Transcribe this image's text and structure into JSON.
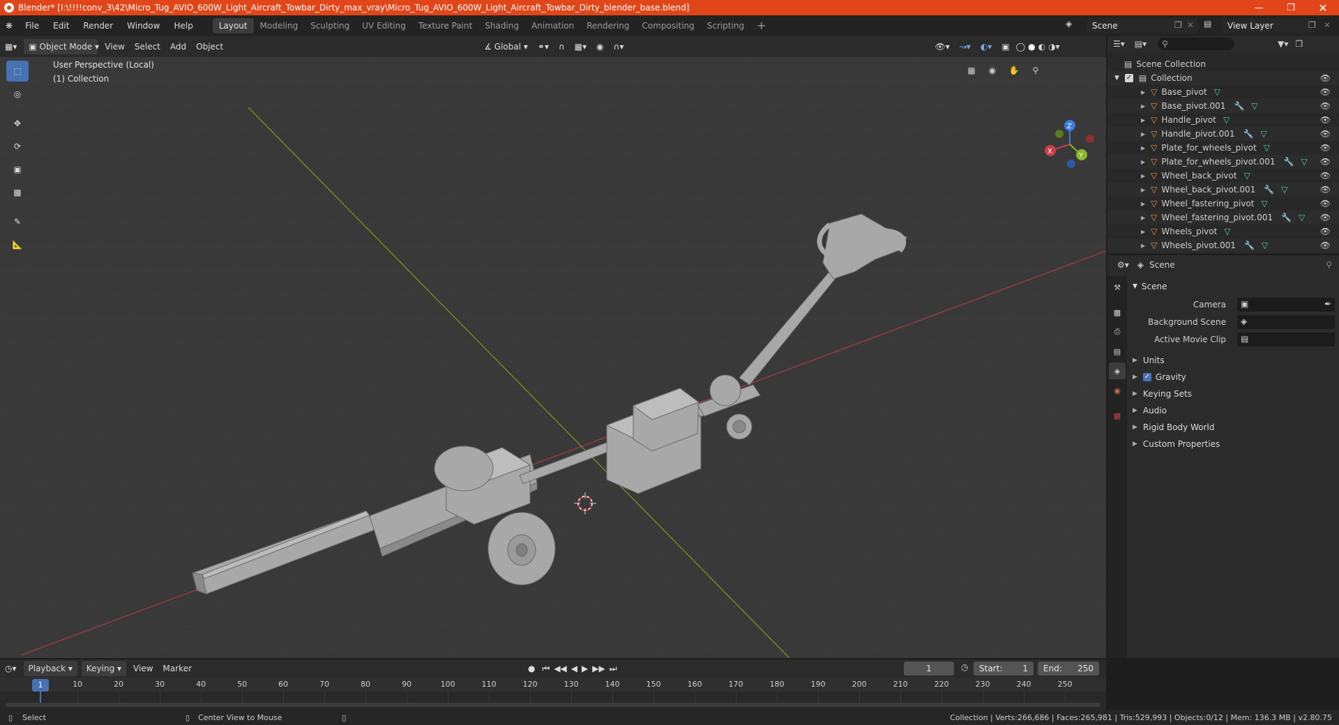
{
  "titlebar": {
    "title": "Blender* [I:\\!!!!conv_3\\42\\Micro_Tug_AVIO_600W_Light_Aircraft_Towbar_Dirty_max_vray\\Micro_Tug_AVIO_600W_Light_Aircraft_Towbar_Dirty_blender_base.blend]"
  },
  "menu": {
    "file": "File",
    "edit": "Edit",
    "render": "Render",
    "window": "Window",
    "help": "Help"
  },
  "workspaces": [
    "Layout",
    "Modeling",
    "Sculpting",
    "UV Editing",
    "Texture Paint",
    "Shading",
    "Animation",
    "Rendering",
    "Compositing",
    "Scripting"
  ],
  "scene": {
    "name": "Scene",
    "view_layer": "View Layer"
  },
  "viewport_header": {
    "mode": "Object Mode",
    "view": "View",
    "select": "Select",
    "add": "Add",
    "object": "Object",
    "orientation": "Global"
  },
  "viewport": {
    "perspective": "User Perspective (Local)",
    "collection": "(1) Collection"
  },
  "gizmo": {
    "x": "X",
    "y": "Y",
    "z": "Z"
  },
  "outliner": {
    "root": "Scene Collection",
    "collection": "Collection",
    "items": [
      {
        "name": "Base_pivot",
        "mod": false
      },
      {
        "name": "Base_pivot.001",
        "mod": true
      },
      {
        "name": "Handle_pivot",
        "mod": false
      },
      {
        "name": "Handle_pivot.001",
        "mod": true
      },
      {
        "name": "Plate_for_wheels_pivot",
        "mod": false
      },
      {
        "name": "Plate_for_wheels_pivot.001",
        "mod": true
      },
      {
        "name": "Wheel_back_pivot",
        "mod": false
      },
      {
        "name": "Wheel_back_pivot.001",
        "mod": true
      },
      {
        "name": "Wheel_fastering_pivot",
        "mod": false
      },
      {
        "name": "Wheel_fastering_pivot.001",
        "mod": true
      },
      {
        "name": "Wheels_pivot",
        "mod": false
      },
      {
        "name": "Wheels_pivot.001",
        "mod": true
      }
    ]
  },
  "properties": {
    "context": "Scene",
    "section": "Scene",
    "camera_label": "Camera",
    "background_label": "Background Scene",
    "movieclip_label": "Active Movie Clip",
    "panels": [
      "Units",
      "Gravity",
      "Keying Sets",
      "Audio",
      "Rigid Body World",
      "Custom Properties"
    ],
    "gravity_checked": true
  },
  "timeline": {
    "playback": "Playback",
    "keying": "Keying",
    "view": "View",
    "marker": "Marker",
    "current_frame": "1",
    "start_label": "Start:",
    "start": "1",
    "end_label": "End:",
    "end": "250",
    "ticks": [
      "10",
      "20",
      "30",
      "40",
      "50",
      "60",
      "70",
      "80",
      "90",
      "100",
      "110",
      "120",
      "130",
      "140",
      "150",
      "160",
      "170",
      "180",
      "190",
      "200",
      "210",
      "220",
      "230",
      "240",
      "250"
    ],
    "playhead": "1"
  },
  "statusbar": {
    "select": "Select",
    "center": "Center View to Mouse",
    "stats": "Collection | Verts:266,686 | Faces:265,981 | Tris:529,993 | Objects:0/12 | Mem: 136.3 MB | v2.80.75"
  },
  "colors": {
    "accent": "#4772b3",
    "titlebar": "#e0461a",
    "x_axis": "#c8404a",
    "y_axis": "#8bb82a",
    "z_axis": "#3a7de0",
    "mesh_icon": "#e8953a"
  }
}
